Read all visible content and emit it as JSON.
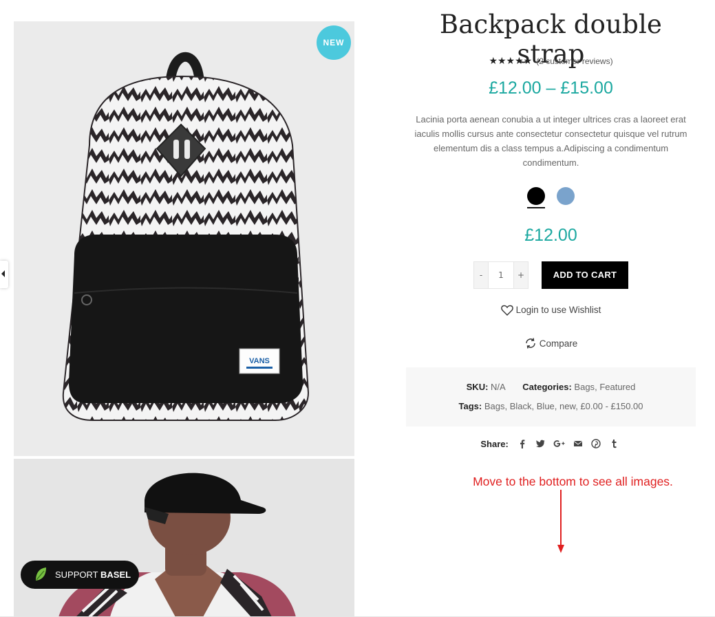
{
  "product": {
    "title": "Backpack double strap",
    "review_text": "(2 customer reviews)",
    "stars": "★★★★★",
    "price_range": "£12.00 – £15.00",
    "description": "Lacinia porta aenean conubia a ut integer ultrices cras a laoreet erat iaculis mollis cursus ante consectetur consectetur quisque vel rutrum elementum dis a class tempus a.Adipiscing a condimentum condimentum.",
    "selected_price": "£12.00",
    "badge": "NEW"
  },
  "swatches": [
    {
      "name": "Black",
      "color": "#000000",
      "selected": true
    },
    {
      "name": "Blue",
      "color": "#7aa3cc",
      "selected": false
    }
  ],
  "cart": {
    "minus": "-",
    "plus": "+",
    "quantity": "1",
    "add_label": "ADD TO CART"
  },
  "actions": {
    "wishlist": "Login to use Wishlist",
    "compare": "Compare"
  },
  "meta": {
    "sku_label": "SKU:",
    "sku_value": "N/A",
    "categories_label": "Categories:",
    "categories": [
      "Bags",
      "Featured"
    ],
    "tags_label": "Tags:",
    "tags": [
      "Bags",
      "Black",
      "Blue",
      "new",
      "£0.00 - £150.00"
    ],
    "sep": ","
  },
  "share": {
    "label": "Share:",
    "icons": [
      "facebook-icon",
      "twitter-icon",
      "google-plus-icon",
      "email-icon",
      "pinterest-icon",
      "tumblr-icon"
    ]
  },
  "annotation": {
    "hint": "Move to the bottom to see all images."
  },
  "support": {
    "prefix": "SUPPORT",
    "brand": "BASEL"
  },
  "colors": {
    "accent": "#1ba8a0",
    "badge": "#4cc9dd",
    "hint": "#e02020"
  }
}
